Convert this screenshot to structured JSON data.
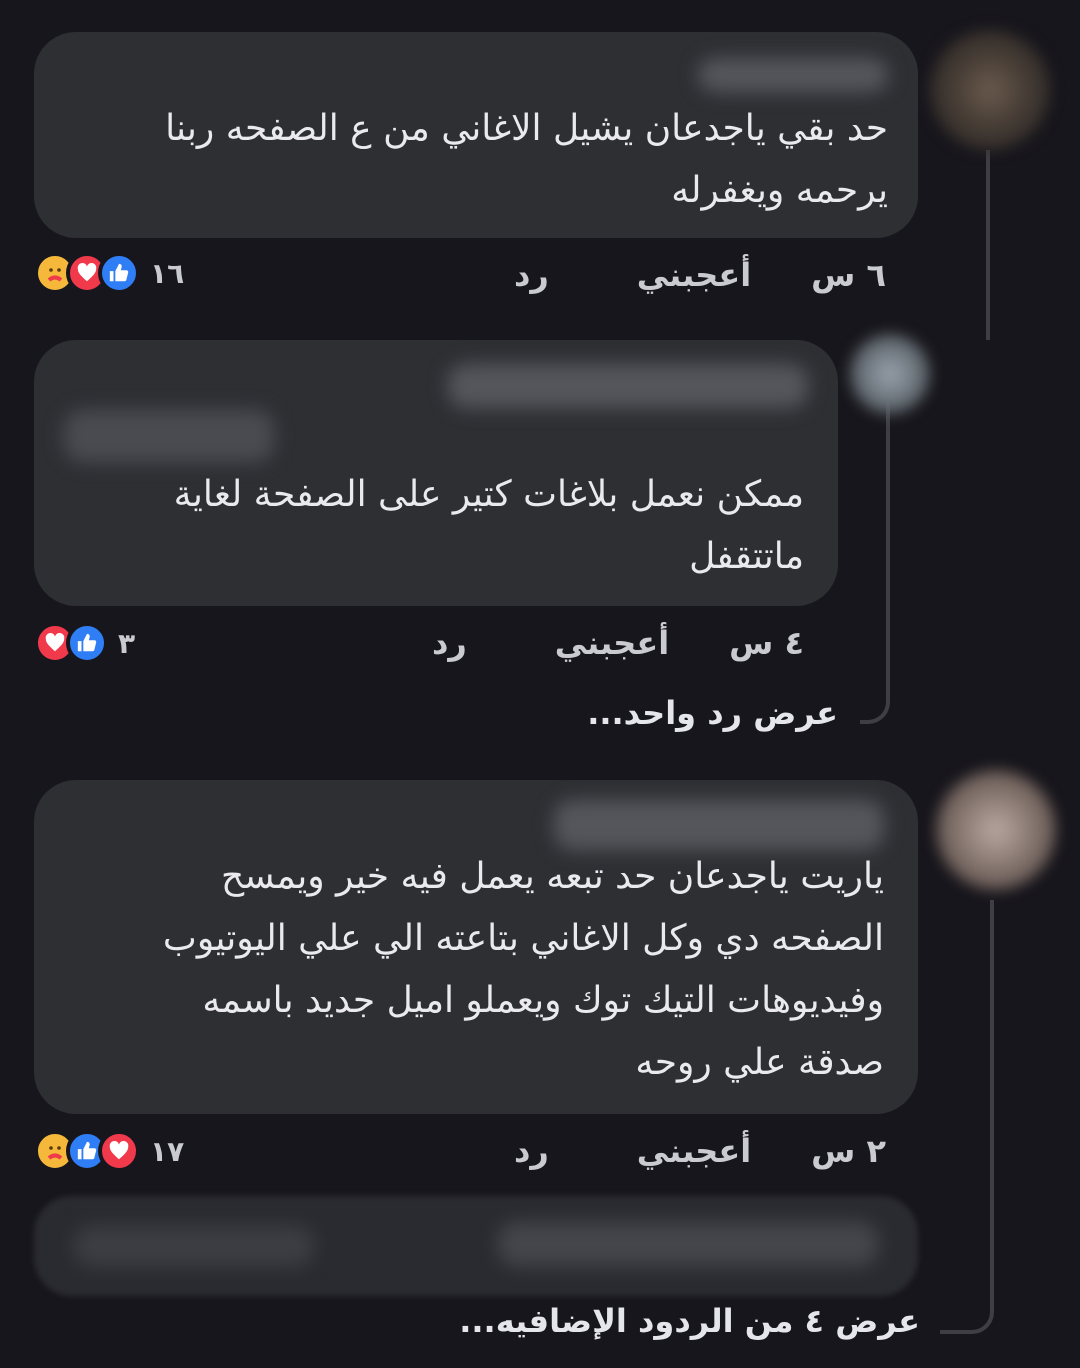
{
  "comments": [
    {
      "text_line1": "حد بقي ياجدعان يشيل الاغاني من ع الصفحه ربنا",
      "text_line2": "يرحمه ويغفرله",
      "time": "٦ س",
      "like_label": "أعجبني",
      "reply_label": "رد",
      "reaction_count": "١٦",
      "reactions": [
        "care",
        "love",
        "like"
      ]
    },
    {
      "text_line1": "ممكن نعمل بلاغات كتير على الصفحة لغاية",
      "text_line2": "ماتتقفل",
      "time": "٤ س",
      "like_label": "أعجبني",
      "reply_label": "رد",
      "reaction_count": "٣",
      "reactions": [
        "love",
        "like"
      ],
      "view_replies": "عرض رد واحد..."
    },
    {
      "text_line1": "ياريت ياجدعان حد تبعه يعمل فيه خير ويمسح",
      "text_line2": "الصفحه دي وكل الاغاني بتاعته الي علي اليوتيوب",
      "text_line3": "وفيديوهات التيك توك ويعملو اميل جديد باسمه",
      "text_line4": "صدقة علي روحه",
      "time": "٢ س",
      "like_label": "أعجبني",
      "reply_label": "رد",
      "reaction_count": "١٧",
      "reactions": [
        "care",
        "like",
        "love"
      ],
      "view_replies": "عرض ٤ من الردود الإضافيه..."
    }
  ],
  "colors": {
    "background": "#17161c",
    "bubble": "#2e2f33",
    "like": "#2f7ef5",
    "love": "#f0394b",
    "care": "#f5b83a"
  },
  "icons": {
    "like": "thumbs-up-icon",
    "love": "heart-icon",
    "care": "care-hug-icon"
  }
}
